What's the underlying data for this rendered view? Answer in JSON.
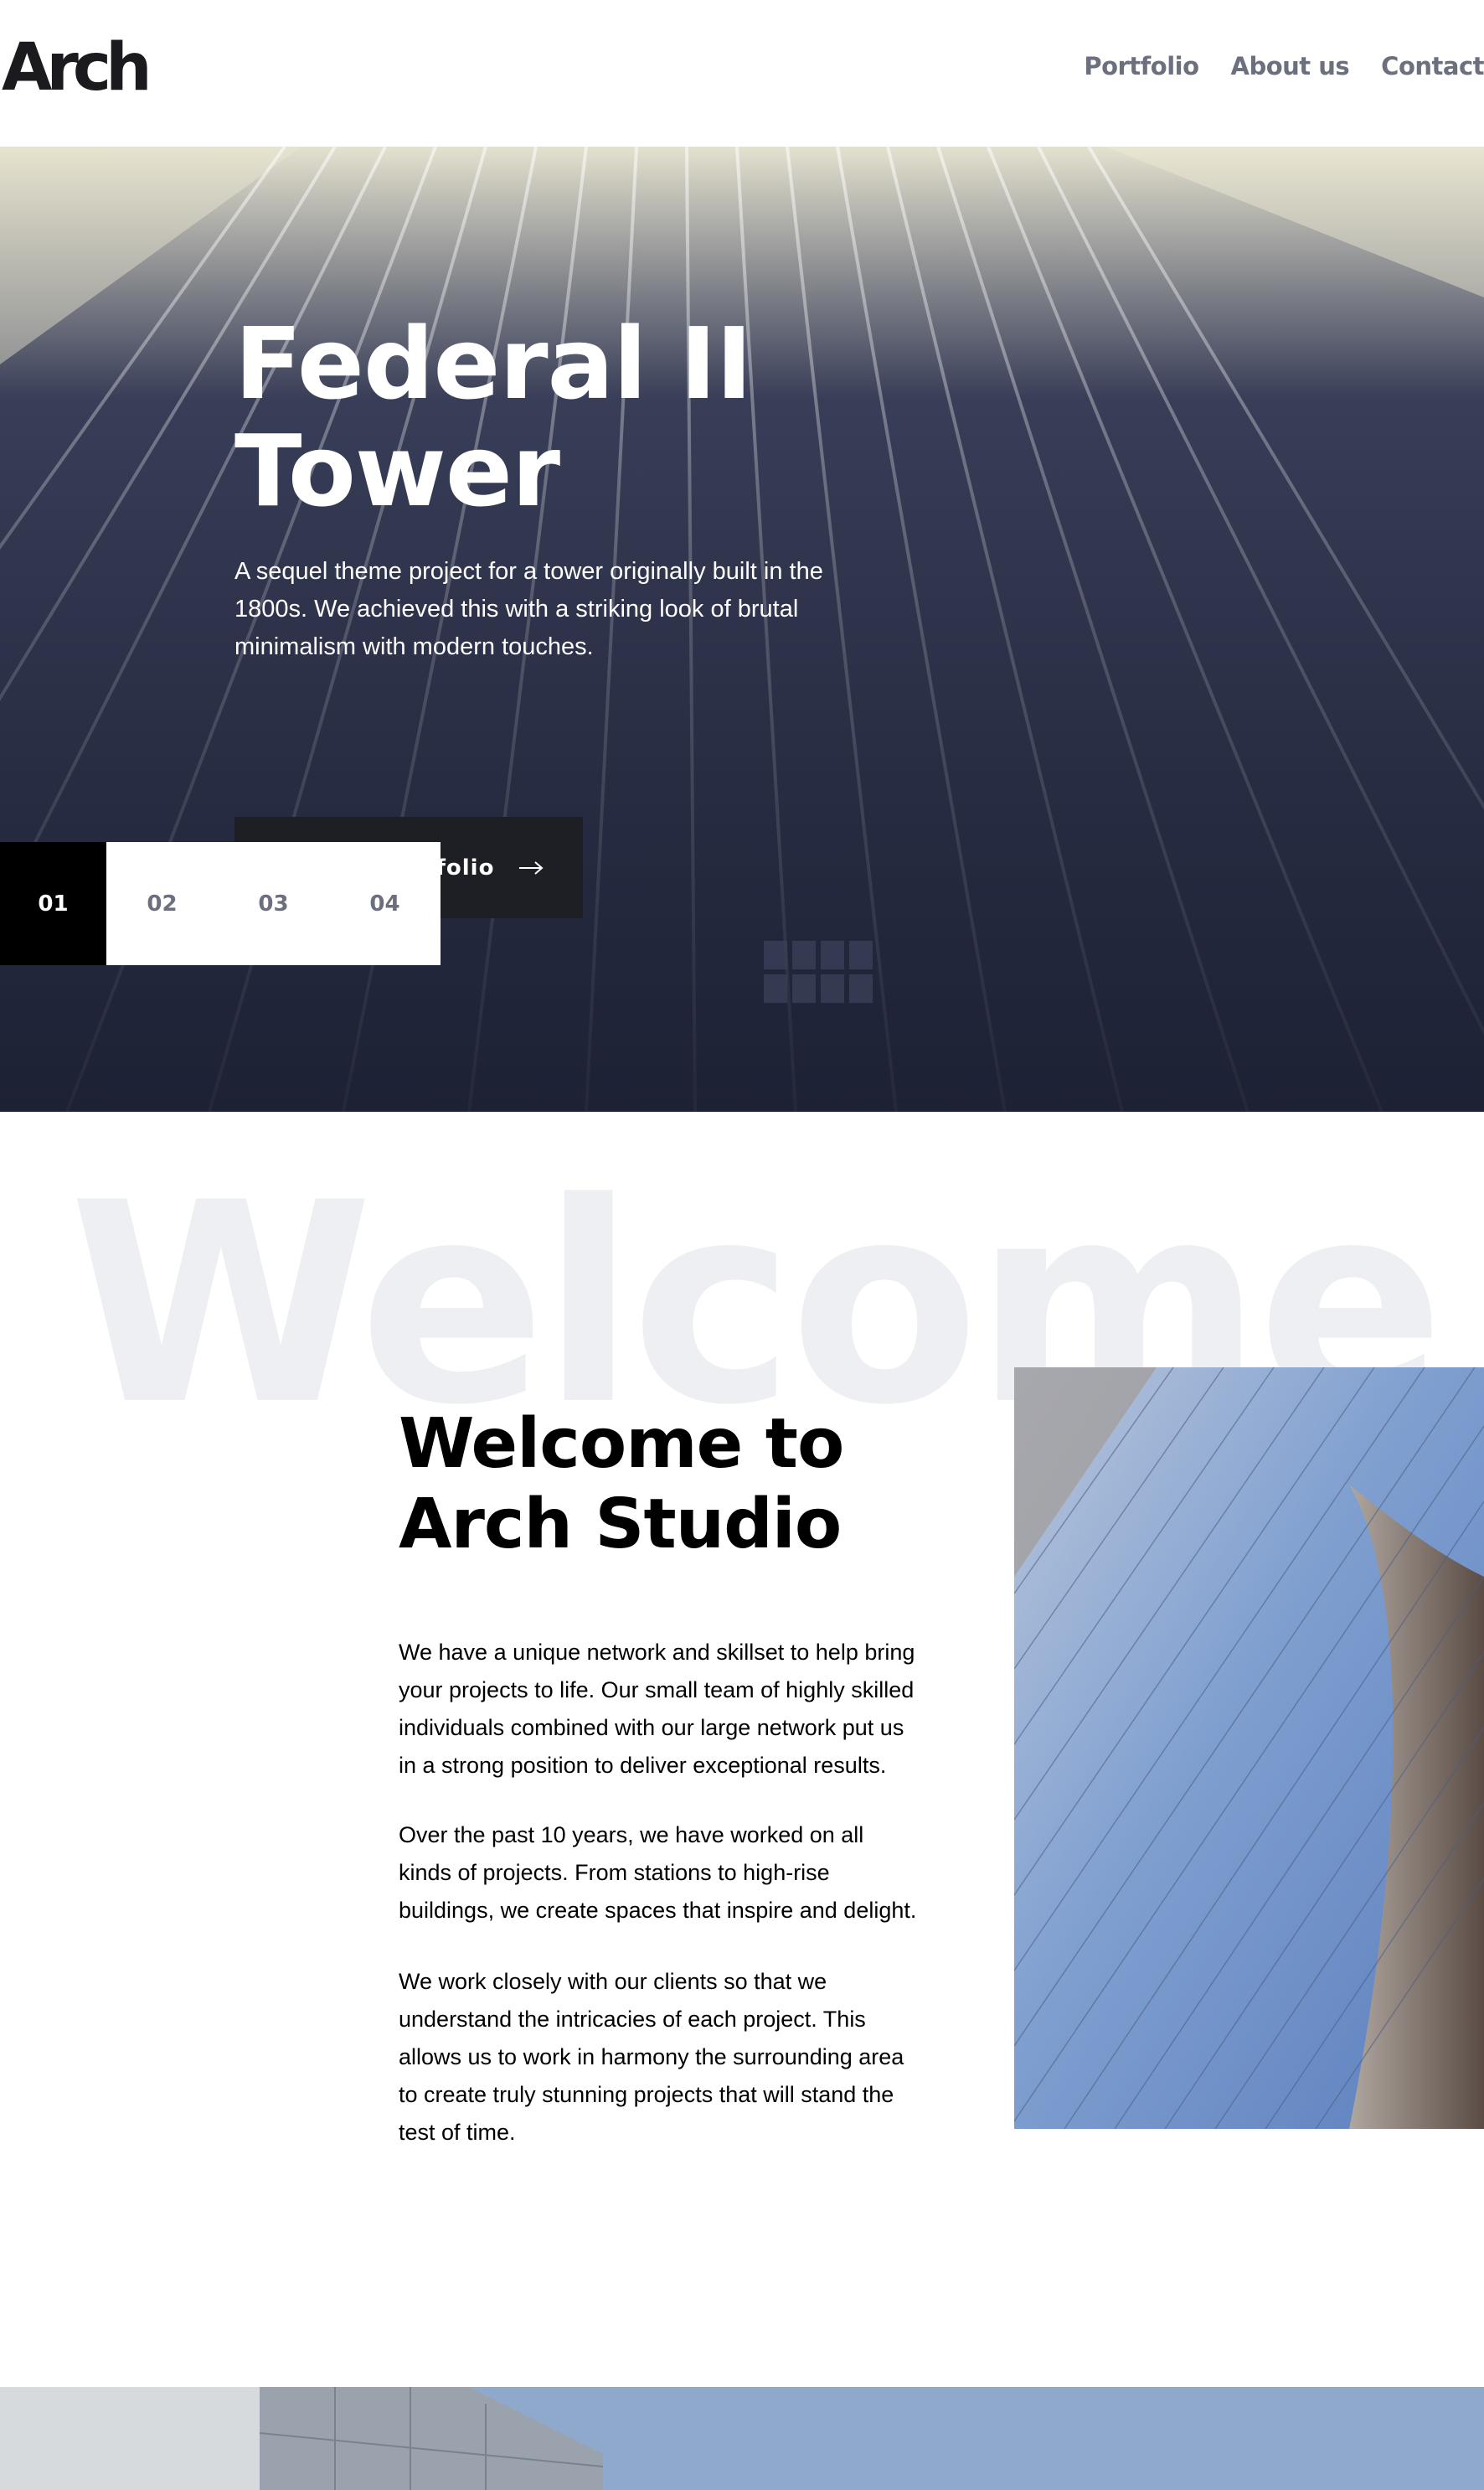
{
  "header": {
    "logo": "Arch",
    "nav": [
      "Portfolio",
      "About us",
      "Contact"
    ]
  },
  "hero": {
    "title_line1": "Federal II",
    "title_line2": "Tower",
    "description": "A sequel theme project for a tower originally built in the 1800s. We achieved this with a striking look of brutal minimalism with modern touches.",
    "button_label": "See out Portfolio",
    "button_icon": "arrow-right-icon",
    "slides": [
      "01",
      "02",
      "03",
      "04"
    ],
    "active_slide": "01"
  },
  "welcome": {
    "background_word": "Welcome",
    "title_line1": "Welcome to",
    "title_line2": "Arch Studio",
    "paragraphs": [
      "We have a unique network and skillset to help bring your projects to life. Our small team of highly skilled individuals combined with our large network put us in a strong position to deliver exceptional results.",
      "Over the past 10 years, we have worked on all kinds of projects. From stations to high-rise buildings, we create spaces that inspire and delight.",
      "We work closely with our clients so that we understand the intricacies of each project. This allows us to work in harmony the surrounding area to create truly stunning projects that will stand the test of time."
    ]
  },
  "colors": {
    "dark": "#1e1f25",
    "nav_text": "#6b6f7e",
    "ghost_text": "#eeeff3"
  }
}
